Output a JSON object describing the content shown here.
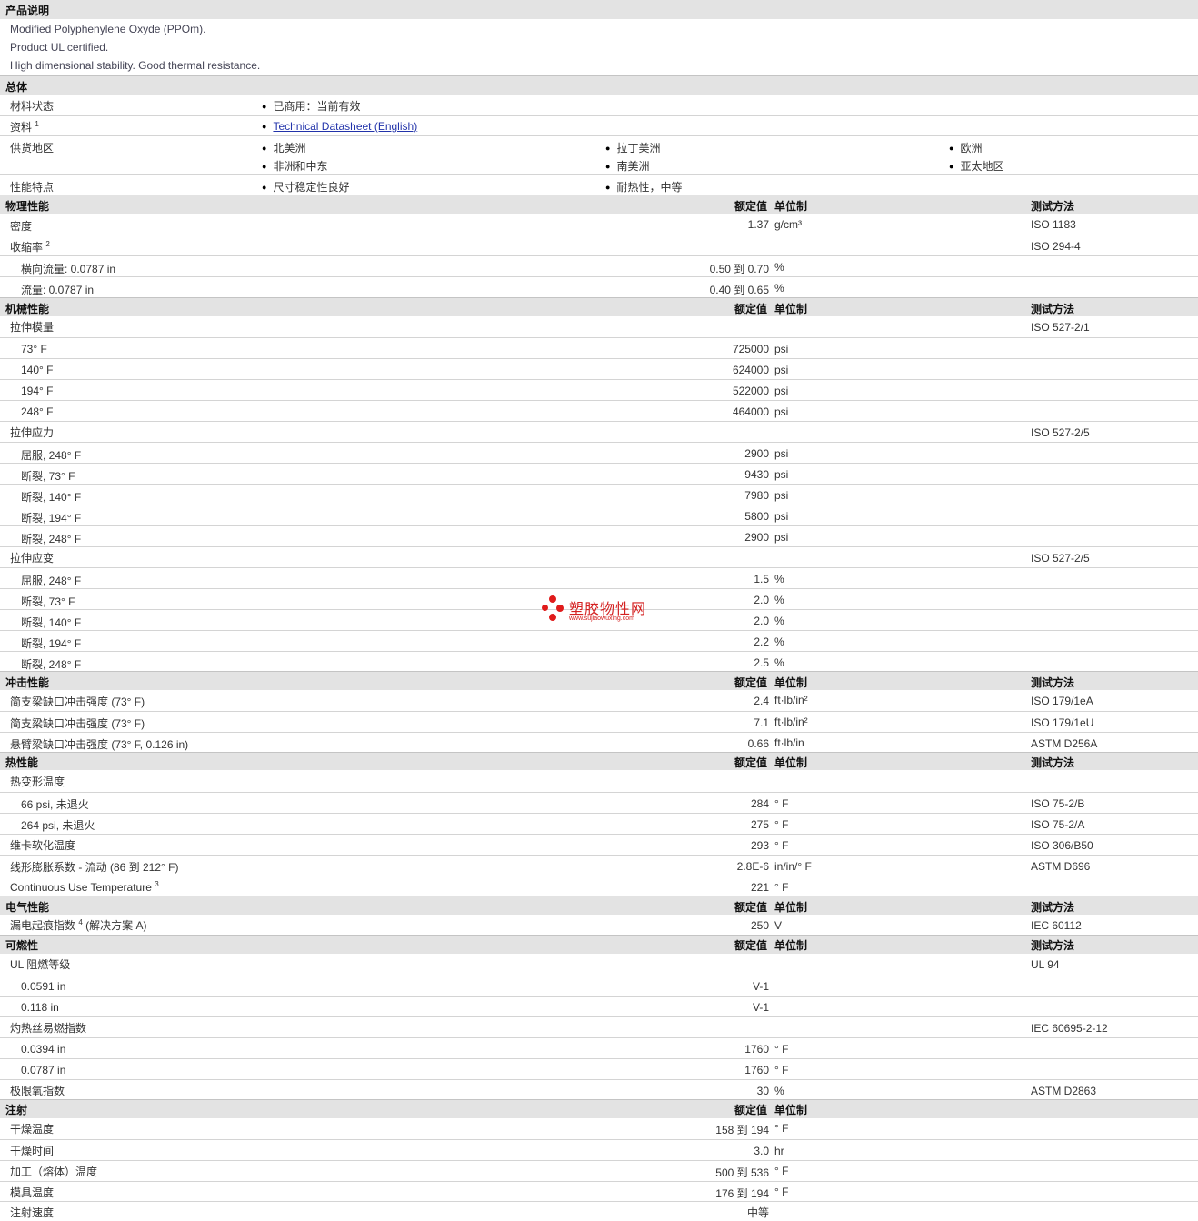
{
  "desc": {
    "title": "产品说明",
    "lines": [
      "Modified Polyphenylene Oxyde (PPOm).",
      "Product UL certified.",
      "High dimensional stability. Good thermal resistance."
    ]
  },
  "general": {
    "title": "总体",
    "status_label": "材料状态",
    "status_value": "已商用：当前有效",
    "doc_label": "资料",
    "doc_sup": "1",
    "doc_link": "Technical Datasheet (English)",
    "region_label": "供货地区",
    "regions": [
      "北美洲",
      "拉丁美洲",
      "欧洲",
      "非洲和中东",
      "南美洲",
      "亚太地区"
    ],
    "feature_label": "性能特点",
    "features": [
      "尺寸稳定性良好",
      "耐热性，中等"
    ]
  },
  "headers": {
    "rated": "额定值",
    "unit": "单位制",
    "test": "测试方法"
  },
  "sections": {
    "physical": {
      "title": "物理性能",
      "density": {
        "label": "密度",
        "value": "1.37",
        "unit": "g/cm³",
        "test": "ISO 1183"
      },
      "shrink": {
        "label": "收缩率",
        "sup": "2",
        "test": "ISO 294-4"
      },
      "shrink_tr": {
        "label": "横向流量: 0.0787 in",
        "value": "0.50 到  0.70",
        "unit": "%"
      },
      "shrink_fl": {
        "label": "流量: 0.0787 in",
        "value": "0.40 到  0.65",
        "unit": "%"
      }
    },
    "mechanical": {
      "title": "机械性能",
      "modulus": {
        "label": "拉伸模量",
        "test": "ISO 527-2/1"
      },
      "modulus_rows": [
        {
          "label": "73° F",
          "value": "725000",
          "unit": "psi"
        },
        {
          "label": "140° F",
          "value": "624000",
          "unit": "psi"
        },
        {
          "label": "194° F",
          "value": "522000",
          "unit": "psi"
        },
        {
          "label": "248° F",
          "value": "464000",
          "unit": "psi"
        }
      ],
      "stress": {
        "label": "拉伸应力",
        "test": "ISO 527-2/5"
      },
      "stress_rows": [
        {
          "label": "屈服, 248° F",
          "value": "2900",
          "unit": "psi"
        },
        {
          "label": "断裂, 73° F",
          "value": "9430",
          "unit": "psi"
        },
        {
          "label": "断裂, 140° F",
          "value": "7980",
          "unit": "psi"
        },
        {
          "label": "断裂, 194° F",
          "value": "5800",
          "unit": "psi"
        },
        {
          "label": "断裂, 248° F",
          "value": "2900",
          "unit": "psi"
        }
      ],
      "strain": {
        "label": "拉伸应变",
        "test": "ISO 527-2/5"
      },
      "strain_rows": [
        {
          "label": "屈服, 248° F",
          "value": "1.5",
          "unit": "%"
        },
        {
          "label": "断裂, 73° F",
          "value": "2.0",
          "unit": "%"
        },
        {
          "label": "断裂, 140° F",
          "value": "2.0",
          "unit": "%"
        },
        {
          "label": "断裂, 194° F",
          "value": "2.2",
          "unit": "%"
        },
        {
          "label": "断裂, 248° F",
          "value": "2.5",
          "unit": "%"
        }
      ]
    },
    "impact": {
      "title": "冲击性能",
      "rows": [
        {
          "label": "简支梁缺口冲击强度 (73° F)",
          "value": "2.4",
          "unit": "ft·lb/in²",
          "test": "ISO 179/1eA"
        },
        {
          "label": "简支梁缺口冲击强度 (73° F)",
          "value": "7.1",
          "unit": "ft·lb/in²",
          "test": "ISO 179/1eU"
        },
        {
          "label": "悬臂梁缺口冲击强度 (73° F, 0.126 in)",
          "value": "0.66",
          "unit": "ft·lb/in",
          "test": "ASTM D256A"
        }
      ]
    },
    "thermal": {
      "title": "热性能",
      "hdt": {
        "label": "热变形温度"
      },
      "hdt_rows": [
        {
          "label": "66 psi, 未退火",
          "value": "284",
          "unit": "° F",
          "test": "ISO 75-2/B"
        },
        {
          "label": "264 psi, 未退火",
          "value": "275",
          "unit": "° F",
          "test": "ISO 75-2/A"
        }
      ],
      "vicat": {
        "label": "维卡软化温度",
        "value": "293",
        "unit": "° F",
        "test": "ISO 306/B50"
      },
      "clte": {
        "label": "线形膨胀系数 - 流动 (86 到 212° F)",
        "value": "2.8E-6",
        "unit": "in/in/° F",
        "test": "ASTM D696"
      },
      "cut": {
        "label": "Continuous Use Temperature",
        "sup": "3",
        "value": "221",
        "unit": "° F"
      }
    },
    "electrical": {
      "title": "电气性能",
      "cti": {
        "label": "漏电起痕指数",
        "sup": "4",
        "label2": "(解决方案 A)",
        "value": "250",
        "unit": "V",
        "test": "IEC 60112"
      }
    },
    "flammability": {
      "title": "可燃性",
      "ul": {
        "label": "UL 阻燃等级",
        "test": "UL 94"
      },
      "ul_rows": [
        {
          "label": "0.0591 in",
          "value": "V-1"
        },
        {
          "label": "0.118 in",
          "value": "V-1"
        }
      ],
      "gwfi": {
        "label": "灼热丝易燃指数",
        "test": "IEC 60695-2-12"
      },
      "gwfi_rows": [
        {
          "label": "0.0394 in",
          "value": "1760",
          "unit": "° F"
        },
        {
          "label": "0.0787 in",
          "value": "1760",
          "unit": "° F"
        }
      ],
      "loi": {
        "label": "极限氧指数",
        "value": "30",
        "unit": "%",
        "test": "ASTM D2863"
      }
    },
    "injection": {
      "title": "注射",
      "rows": [
        {
          "label": "干燥温度",
          "value": "158 到  194",
          "unit": "° F"
        },
        {
          "label": "干燥时间",
          "value": "3.0",
          "unit": "hr"
        },
        {
          "label": "加工（熔体）温度",
          "value": "500 到  536",
          "unit": "° F"
        },
        {
          "label": "模具温度",
          "value": "176 到  194",
          "unit": "° F"
        },
        {
          "label": "注射速度",
          "value": "中等",
          "unit": ""
        }
      ]
    }
  },
  "watermark": {
    "cn": "塑胶物性网",
    "en": "www.sujiaowuxing.com",
    "color": "#e01b1b"
  }
}
